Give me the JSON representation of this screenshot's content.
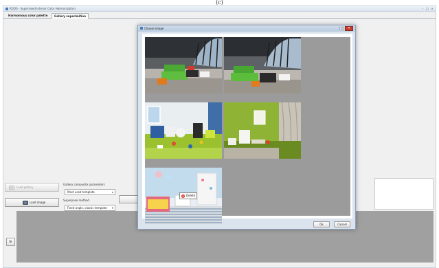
{
  "caption": "(c)",
  "window": {
    "title": "ROOS - Supervised Interior Color Harmonization",
    "minimize": "–",
    "maximize": "□",
    "close": "✕"
  },
  "tabs": [
    {
      "label": "Harmonious color palette",
      "selected": false
    },
    {
      "label": "Gallery superimition",
      "selected": true
    }
  ],
  "left_panel": {
    "load_gallery": "Load gallery",
    "load_image": "Load image",
    "gallery_params_label": "Gallery composite parameters",
    "template_value": "Most used template",
    "superpose_label": "Superpose method",
    "method_value": "Fixed angle, classic template",
    "side_button_glyph": "⊞"
  },
  "dialog": {
    "title": "Choose image",
    "help": "?",
    "close": "✕",
    "ok": "Ok",
    "cancel": "Cancel",
    "popup_icon": "✕",
    "popup_label": "Delete",
    "images": [
      {
        "name": "lobby-green-sofas-left"
      },
      {
        "name": "lobby-green-sofas-right"
      },
      {
        "name": "kids-room-blue-green"
      },
      {
        "name": "green-room-curtains"
      },
      {
        "name": "nursery-striped-floor"
      }
    ]
  },
  "colors": {
    "grid_bg": "#9b9b9b",
    "dialog_frame": "#dbe4ee",
    "close_red": "#cc3a2a",
    "canvas_gray": "#a0a0a0"
  }
}
